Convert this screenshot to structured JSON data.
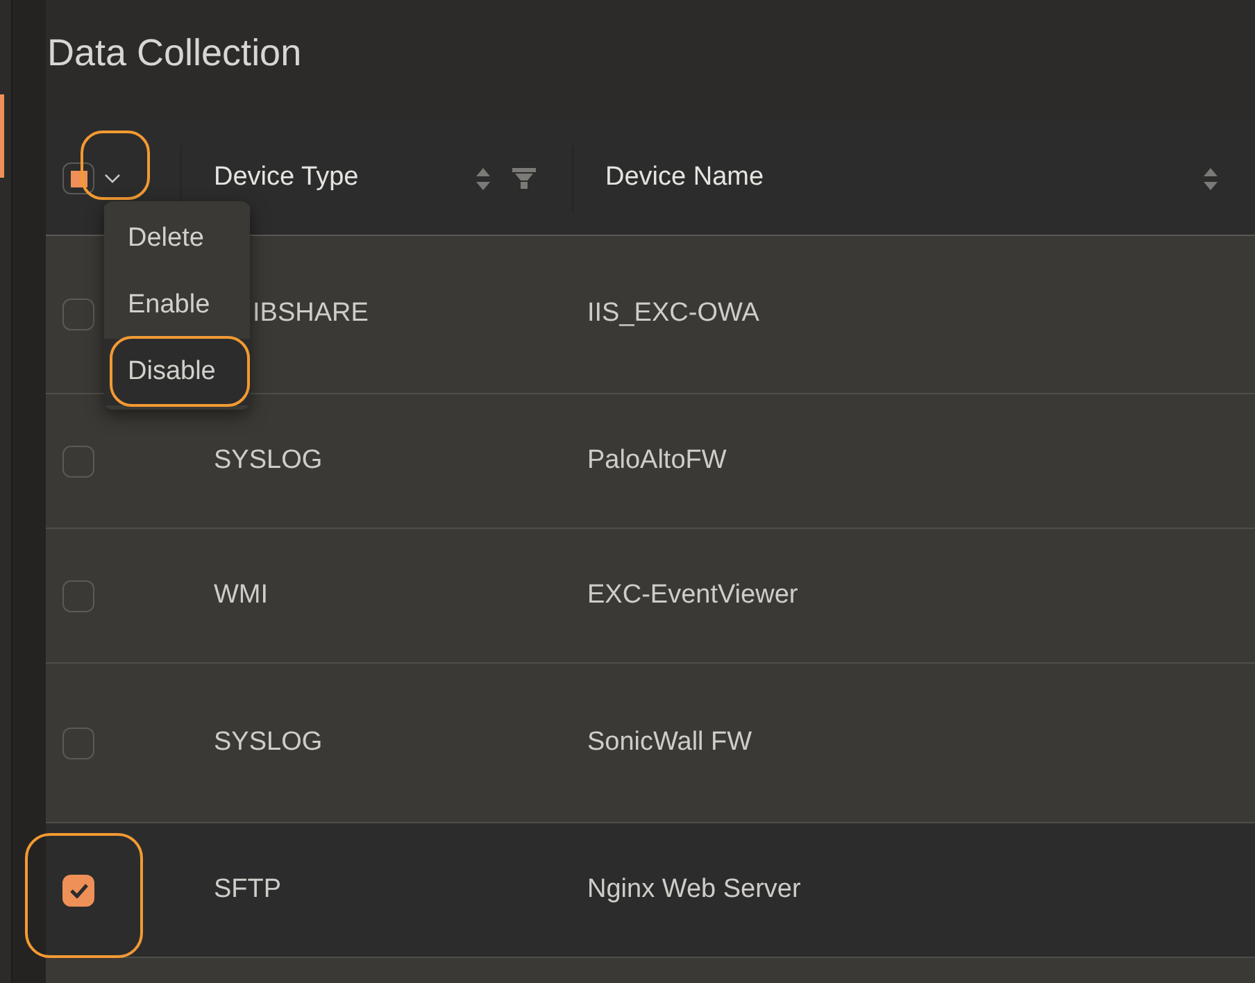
{
  "title": "Data Collection",
  "table": {
    "select_all": {
      "partial": true,
      "menu_highlighted": true
    },
    "columns": [
      {
        "label": "Device Type",
        "sortable": true,
        "filterable": true
      },
      {
        "label": "Device Name",
        "sortable": true,
        "filterable": false
      }
    ],
    "rows": [
      {
        "device_type": "IBSHARE",
        "device_name": "IIS_EXC-OWA",
        "checked": false,
        "selected": false,
        "highlighted": false,
        "covered": true
      },
      {
        "device_type": "SYSLOG",
        "device_name": "PaloAltoFW",
        "checked": false,
        "selected": false,
        "highlighted": false,
        "covered": false
      },
      {
        "device_type": "WMI",
        "device_name": "EXC-EventViewer",
        "checked": false,
        "selected": false,
        "highlighted": false,
        "covered": false
      },
      {
        "device_type": "SYSLOG",
        "device_name": "SonicWall FW",
        "checked": false,
        "selected": false,
        "highlighted": false,
        "covered": false
      },
      {
        "device_type": "SFTP",
        "device_name": "Nginx Web Server",
        "checked": true,
        "selected": true,
        "highlighted": true,
        "covered": false
      }
    ]
  },
  "bulk_menu": {
    "open": true,
    "items": [
      {
        "label": "Delete",
        "hovered": false,
        "highlighted": false
      },
      {
        "label": "Enable",
        "hovered": false,
        "highlighted": false
      },
      {
        "label": "Disable",
        "hovered": true,
        "highlighted": true
      }
    ]
  }
}
